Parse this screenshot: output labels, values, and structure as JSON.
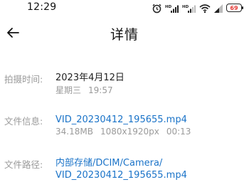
{
  "status_bar": {
    "time": "12:29",
    "icons": [
      "alarm-icon",
      "hd-signal-icon",
      "hd-signal-icon",
      "wifi-icon",
      "signal-icon",
      "battery-icon"
    ],
    "signal_badge": "HD",
    "battery_level": "69",
    "battery_color": "#e53935"
  },
  "header": {
    "back_icon": "back-arrow-icon",
    "title": "详情"
  },
  "details": {
    "capture_time": {
      "label": "拍摄时间:",
      "date": "2023年4月12日",
      "weekday": "星期三",
      "time": "19:57"
    },
    "file_info": {
      "label": "文件信息:",
      "filename": "VID_20230412_195655.mp4",
      "size": "34.18MB",
      "resolution": "1080x1920px",
      "duration": "00:13"
    },
    "file_path": {
      "label": "文件路径:",
      "path_line1": "内部存储/DCIM/Camera/",
      "path_line2": "VID_20230412_195655.mp4"
    }
  },
  "colors": {
    "link": "#1a73c8",
    "label": "#9a9a9a",
    "text": "#222222"
  }
}
